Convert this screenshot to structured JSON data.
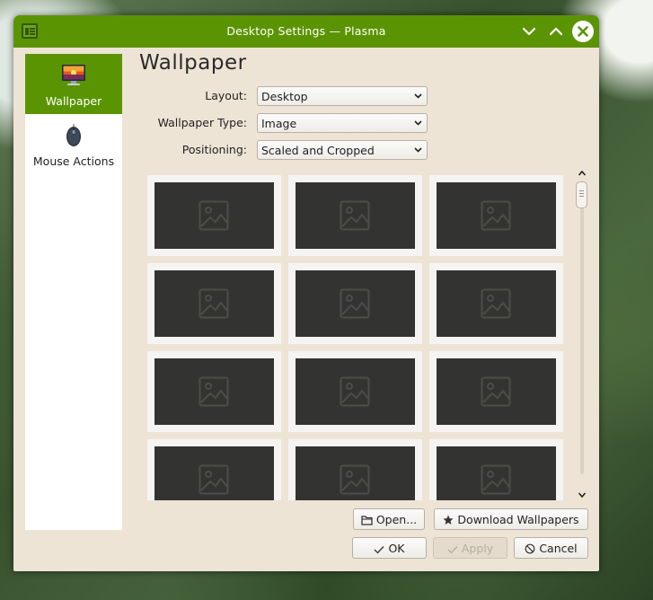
{
  "window": {
    "title": "Desktop Settings — Plasma"
  },
  "sidebar": {
    "items": [
      {
        "label": "Wallpaper",
        "icon": "wallpaper-icon",
        "active": true
      },
      {
        "label": "Mouse Actions",
        "icon": "mouse-icon",
        "active": false
      }
    ]
  },
  "page": {
    "title": "Wallpaper"
  },
  "form": {
    "layout": {
      "label": "Layout:",
      "value": "Desktop"
    },
    "wallpaper_type": {
      "label": "Wallpaper Type:",
      "value": "Image"
    },
    "positioning": {
      "label": "Positioning:",
      "value": "Scaled and Cropped"
    }
  },
  "buttons": {
    "open": "Open...",
    "download": "Download Wallpapers",
    "ok": "OK",
    "apply": "Apply",
    "cancel": "Cancel"
  },
  "colors": {
    "accent": "#5b9402",
    "window_bg": "#ede4d6",
    "thumbnail_bg": "#333331"
  }
}
